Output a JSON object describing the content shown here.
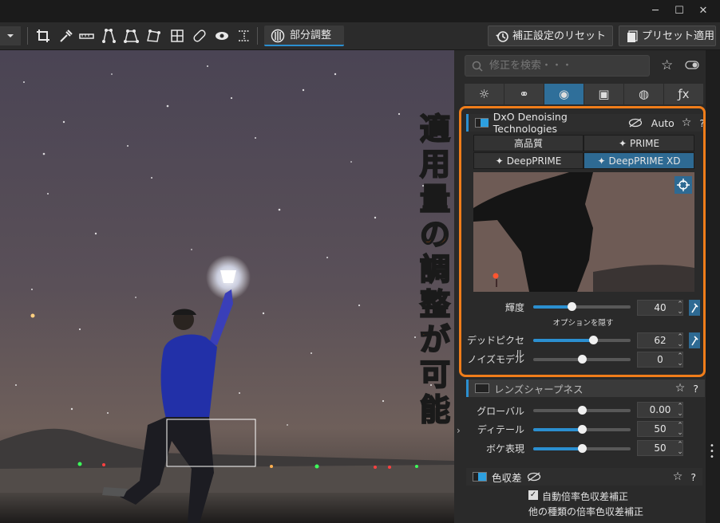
{
  "window": {
    "minimize": "─",
    "maximize": "☐",
    "close": "✕"
  },
  "toolbar": {
    "dropdown_icon": "chevron-down-icon",
    "tools": [
      "crop-icon",
      "eyedropper-icon",
      "straighten-icon",
      "perspective-4pt-icon",
      "perspective-8pt-icon",
      "perspective-rect-icon",
      "grid-icon",
      "repair-icon",
      "eye-icon",
      "split-view-icon"
    ],
    "local_adjust_label": "部分調整",
    "reset_label": "補正設定のリセット",
    "preset_label": "プリセット適用"
  },
  "panel": {
    "search_placeholder": "修正を検索・・・",
    "tabs": [
      "☼",
      "⚭",
      "◉",
      "▣",
      "◍",
      "ƒx"
    ],
    "active_tab": 2,
    "denoise": {
      "title": "DxO Denoising Technologies",
      "auto_label": "Auto",
      "help": "?",
      "modes": [
        "高品質",
        "PRIME",
        "DeepPRIME",
        "DeepPRIME XD"
      ],
      "active_mode": 3,
      "luminance_label": "輝度",
      "luminance_value": "40",
      "luminance_level": 0.4,
      "hide_options_label": "オプションを隠す",
      "dead_pixel_label": "デッドピクセル",
      "dead_pixel_value": "62",
      "dead_pixel_level": 0.62,
      "noise_model_label": "ノイズモデル",
      "noise_model_value": "0",
      "noise_model_level": 0.5
    },
    "lens_sharpness": {
      "title": "レンズシャープネス",
      "help": "?",
      "global_label": "グローバル",
      "global_value": "0.00",
      "detail_label": "ディテール",
      "detail_value": "50",
      "bokeh_label": "ボケ表現",
      "bokeh_value": "50"
    },
    "chroma": {
      "title": "色収差",
      "help": "?",
      "auto_mag_label": "自動倍率色収差補正",
      "other_mag_label": "他の種類の倍率色収差補正"
    }
  },
  "annotation": {
    "callout_text": "適用量の調整が可能"
  },
  "colors": {
    "accent": "#2e6a93",
    "highlight": "#f07d1a"
  }
}
